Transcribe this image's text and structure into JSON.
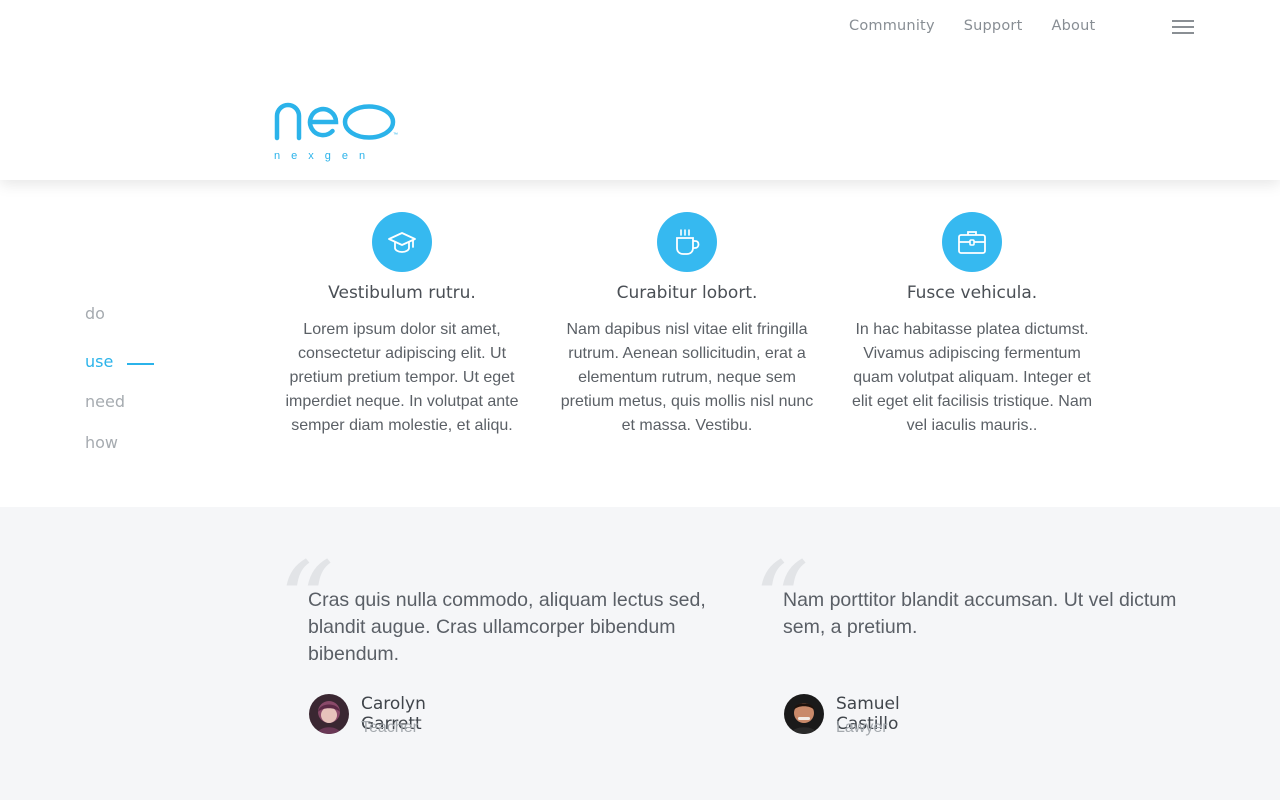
{
  "nav": {
    "links": [
      "Community",
      "Support",
      "About"
    ]
  },
  "brand": {
    "name": "neo",
    "tagline": "nexgen",
    "color": "#2bb3ea"
  },
  "side_nav": {
    "items": [
      "do",
      "use",
      "need",
      "how"
    ],
    "active": "use"
  },
  "features": [
    {
      "icon": "graduation-cap-icon",
      "title": "Vestibulum rutru.",
      "text": "Lorem ipsum dolor sit amet, consectetur adipiscing elit. Ut pretium pretium tempor. Ut eget imperdiet neque. In volutpat ante semper diam molestie, et aliqu."
    },
    {
      "icon": "coffee-cup-icon",
      "title": "Curabitur lobort.",
      "text": "Nam dapibus nisl vitae elit fringilla rutrum. Aenean sollicitudin, erat a elementum rutrum, neque sem pretium metus, quis mollis nisl nunc et massa. Vestibu."
    },
    {
      "icon": "briefcase-icon",
      "title": "Fusce vehicula.",
      "text": "In hac habitasse platea dictumst. Vivamus adipiscing fermentum quam volutpat aliquam. Integer et elit eget elit facilisis tristique. Nam vel iaculis mauris.."
    }
  ],
  "testimonials": [
    {
      "quote": "Cras quis nulla commodo, aliquam lectus sed, blandit augue. Cras ullamcorper bibendum bibendum.",
      "name": "Carolyn Garrett",
      "role": "Teacher"
    },
    {
      "quote": "Nam porttitor blandit accumsan. Ut vel dictum sem, a pretium.",
      "name": "Samuel Castillo",
      "role": "Lawyer"
    }
  ],
  "colors": {
    "accent": "#36b9f0",
    "testimonial_bg": "#f5f6f8"
  }
}
